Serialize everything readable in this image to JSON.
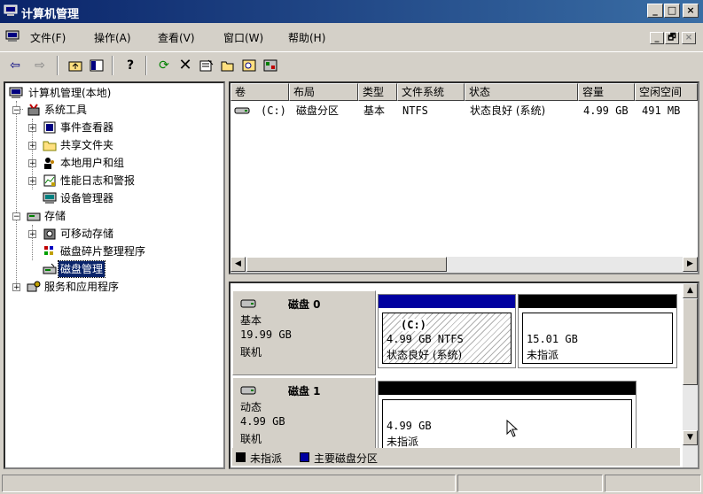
{
  "window": {
    "title": "计算机管理",
    "buttons": {
      "minimize": "_",
      "maximize": "□",
      "close": "×"
    }
  },
  "menu": {
    "items": [
      "文件(F)",
      "操作(A)",
      "查看(V)",
      "窗口(W)",
      "帮助(H)"
    ],
    "mdi": {
      "minimize": "_",
      "restore": "🗗",
      "close": "×"
    }
  },
  "toolbar": {
    "icons": [
      "back-arrow-icon",
      "forward-arrow-icon",
      "up-folder-icon",
      "show-hide-tree-icon",
      "help-icon",
      "refresh-icon",
      "delete-icon",
      "properties-icon",
      "open-folder-icon",
      "search-disk-icon",
      "wizard-icon"
    ]
  },
  "tree": {
    "root": "计算机管理(本地)",
    "system_tools": "系统工具",
    "event_viewer": "事件查看器",
    "shared_folders": "共享文件夹",
    "local_users": "本地用户和组",
    "perf_logs": "性能日志和警报",
    "device_manager": "设备管理器",
    "storage": "存储",
    "removable_storage": "可移动存储",
    "defrag": "磁盘碎片整理程序",
    "disk_management": "磁盘管理",
    "services_apps": "服务和应用程序",
    "expanders": {
      "plus": "+",
      "minus": "−"
    }
  },
  "volume_list": {
    "columns": [
      "卷",
      "布局",
      "类型",
      "文件系统",
      "状态",
      "容量",
      "空闲空间"
    ],
    "rows": [
      {
        "volume": "(C:)",
        "layout": "磁盘分区",
        "type": "基本",
        "fs": "NTFS",
        "status": "状态良好 (系统)",
        "capacity": "4.99 GB",
        "free": "491 MB"
      }
    ]
  },
  "disks": [
    {
      "name": "磁盘 0",
      "type": "基本",
      "size": "19.99 GB",
      "state": "联机",
      "partitions": [
        {
          "label": "(C:)",
          "size": "4.99 GB NTFS",
          "status": "状态良好 (系统)"
        },
        {
          "size": "15.01 GB",
          "status": "未指派"
        }
      ]
    },
    {
      "name": "磁盘 1",
      "type": "动态",
      "size": "4.99 GB",
      "state": "联机",
      "partitions": [
        {
          "size": "4.99 GB",
          "status": "未指派"
        }
      ]
    }
  ],
  "legend": {
    "unallocated": "未指派",
    "primary": "主要磁盘分区"
  },
  "colors": {
    "titlebar": "#0a246a",
    "primary_partition": "#0000a0",
    "unallocated": "#000000",
    "selection": "#0a246a"
  }
}
